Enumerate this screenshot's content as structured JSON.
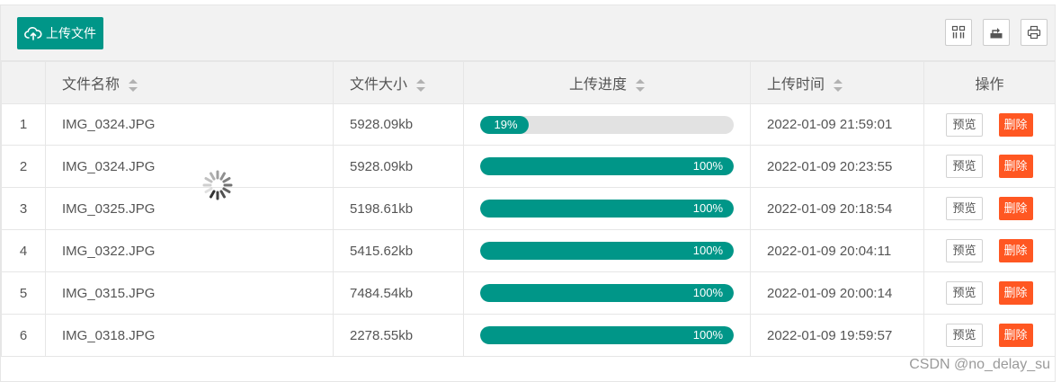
{
  "toolbar": {
    "upload_label": "上传文件",
    "upload_icon": "cloud-upload-icon",
    "tools": [
      "columns-filter-icon",
      "export-icon",
      "print-icon"
    ]
  },
  "table": {
    "headers": {
      "index": "",
      "name": "文件名称",
      "size": "文件大小",
      "progress": "上传进度",
      "time": "上传时间",
      "actions": "操作"
    },
    "rows": [
      {
        "index": "1",
        "name": "IMG_0324.JPG",
        "size": "5928.09kb",
        "progress": 0.19,
        "progress_label": "19%",
        "time": "2022-01-09 21:59:01"
      },
      {
        "index": "2",
        "name": "IMG_0324.JPG",
        "size": "5928.09kb",
        "progress": 1.0,
        "progress_label": "100%",
        "time": "2022-01-09 20:23:55"
      },
      {
        "index": "3",
        "name": "IMG_0325.JPG",
        "size": "5198.61kb",
        "progress": 1.0,
        "progress_label": "100%",
        "time": "2022-01-09 20:18:54"
      },
      {
        "index": "4",
        "name": "IMG_0322.JPG",
        "size": "5415.62kb",
        "progress": 1.0,
        "progress_label": "100%",
        "time": "2022-01-09 20:04:11"
      },
      {
        "index": "5",
        "name": "IMG_0315.JPG",
        "size": "7484.54kb",
        "progress": 1.0,
        "progress_label": "100%",
        "time": "2022-01-09 20:00:14"
      },
      {
        "index": "6",
        "name": "IMG_0318.JPG",
        "size": "2278.55kb",
        "progress": 1.0,
        "progress_label": "100%",
        "time": "2022-01-09 19:59:57"
      }
    ],
    "preview_label": "预览",
    "delete_label": "删除"
  },
  "colors": {
    "primary": "#009688",
    "danger": "#ff5722",
    "track": "#e2e2e2"
  },
  "watermark": "CSDN @no_delay_su"
}
